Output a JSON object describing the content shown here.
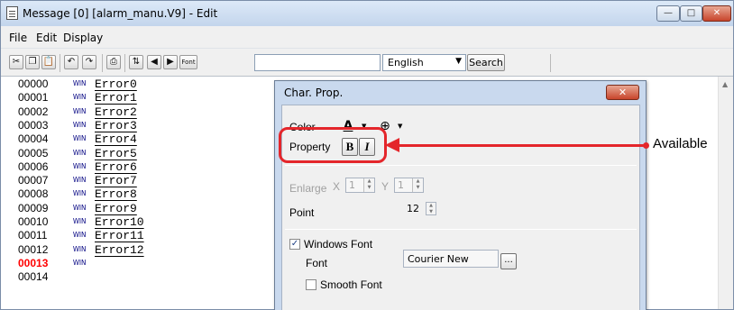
{
  "window": {
    "title": "Message [0] [alarm_manu.V9] - Edit",
    "controls": {
      "minimize": "—",
      "maximize": "□",
      "close": "✕"
    }
  },
  "menu": [
    "File",
    "Edit",
    "Display"
  ],
  "toolbar": {
    "font_label": "Font",
    "language": "English",
    "search_label": "Search",
    "text_value": ""
  },
  "rows": [
    {
      "num": "00000",
      "tag": "WIN",
      "text": "Error0"
    },
    {
      "num": "00001",
      "tag": "WIN",
      "text": "Error1"
    },
    {
      "num": "00002",
      "tag": "WIN",
      "text": "Error2"
    },
    {
      "num": "00003",
      "tag": "WIN",
      "text": "Error3"
    },
    {
      "num": "00004",
      "tag": "WIN",
      "text": "Error4"
    },
    {
      "num": "00005",
      "tag": "WIN",
      "text": "Error5"
    },
    {
      "num": "00006",
      "tag": "WIN",
      "text": "Error6"
    },
    {
      "num": "00007",
      "tag": "WIN",
      "text": "Error7"
    },
    {
      "num": "00008",
      "tag": "WIN",
      "text": "Error8"
    },
    {
      "num": "00009",
      "tag": "WIN",
      "text": "Error9"
    },
    {
      "num": "00010",
      "tag": "WIN",
      "text": "Error10"
    },
    {
      "num": "00011",
      "tag": "WIN",
      "text": "Error11"
    },
    {
      "num": "00012",
      "tag": "WIN",
      "text": "Error12"
    },
    {
      "num": "00013",
      "tag": "WIN",
      "text": ""
    },
    {
      "num": "00014",
      "tag": "",
      "text": ""
    }
  ],
  "highlight_row": "00013",
  "dialog": {
    "title": "Char. Prop.",
    "close": "✕",
    "color_label": "Color",
    "fg_icon": "A",
    "bg_icon": "⊕",
    "property_label": "Property",
    "bold_label": "B",
    "italic_label": "I",
    "enlarge_label": "Enlarge",
    "enlarge_x_label": "X",
    "enlarge_x": "1",
    "enlarge_y_label": "Y",
    "enlarge_y": "1",
    "point_label": "Point",
    "point_value": "12",
    "windows_font_label": "Windows Font",
    "windows_font_checked": "✓",
    "font_label": "Font",
    "font_value": "Courier New",
    "browse_label": "...",
    "smooth_font_label": "Smooth Font"
  },
  "annotation": {
    "text": "Available"
  },
  "colors": {
    "highlight": "#ff0000",
    "annotation": "#e4262b",
    "tag": "#000080"
  }
}
